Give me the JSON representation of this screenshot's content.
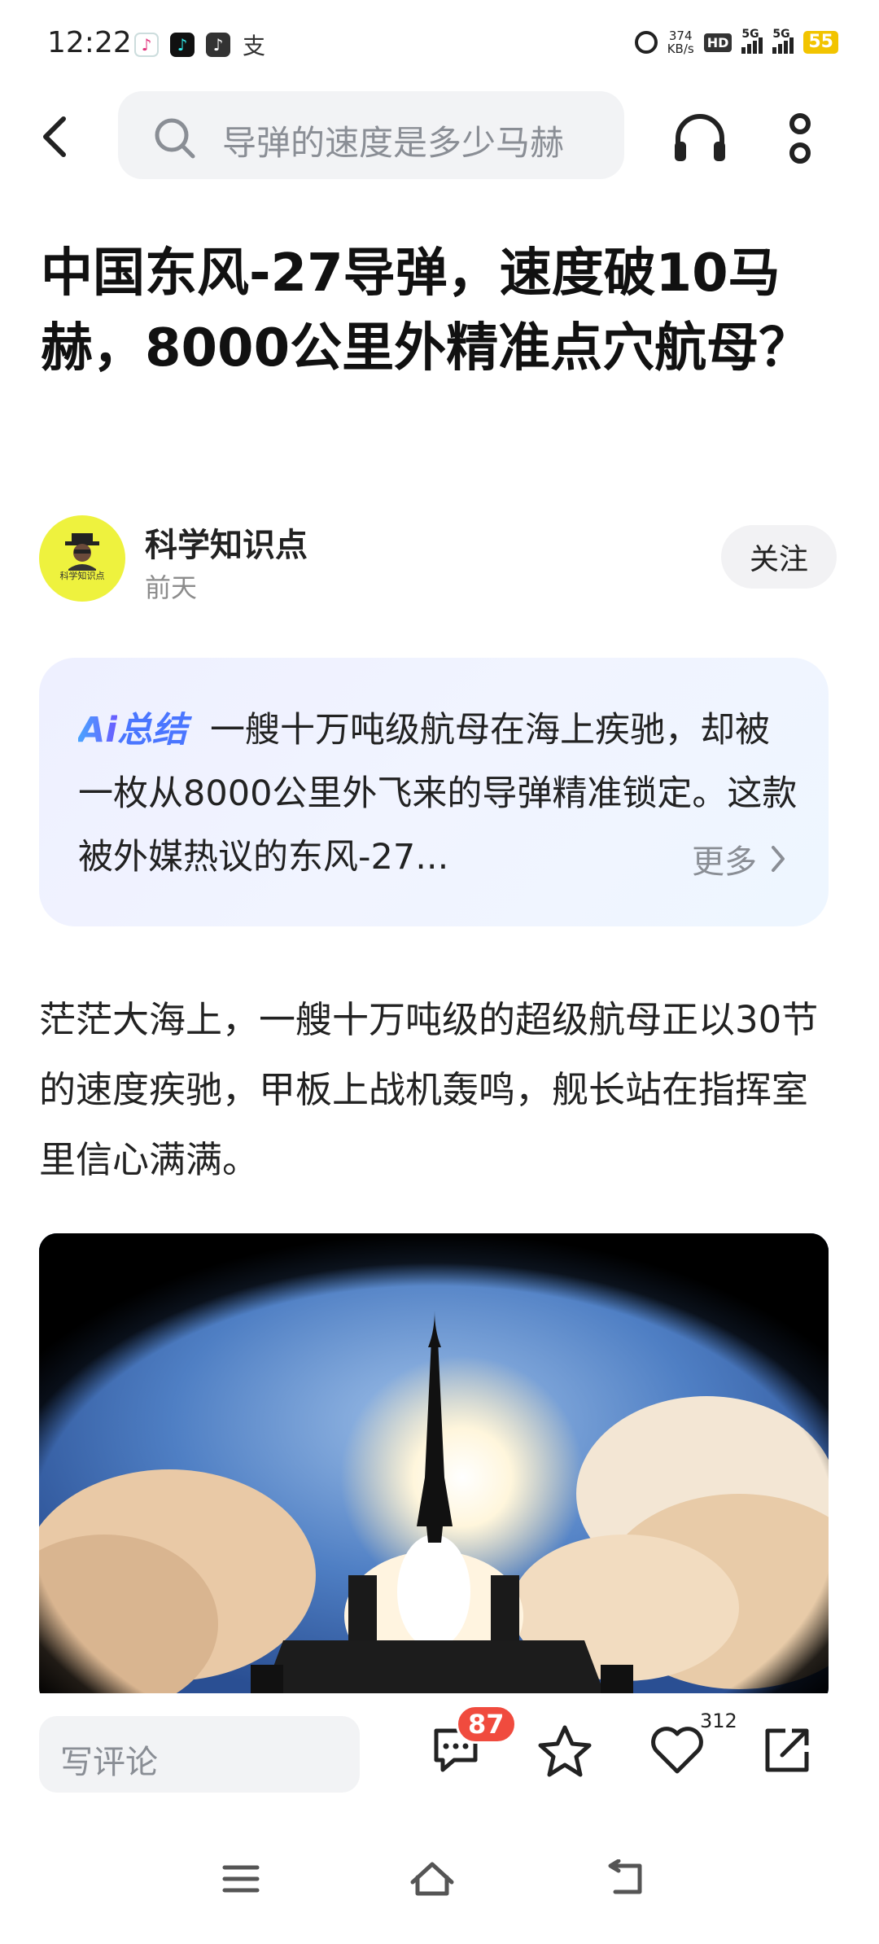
{
  "status_bar": {
    "time": "12:22",
    "net_speed_value": "374",
    "net_speed_unit": "KB/s",
    "hd_label": "HD",
    "signal1_label": "5G",
    "signal2_label": "5G",
    "battery": "55"
  },
  "nav": {
    "search_text": "导弹的速度是多少马赫"
  },
  "article": {
    "title": "中国东风-27导弹，速度破10马赫，8000公里外精准点穴航母？",
    "author_name": "科学知识点",
    "avatar_caption": "科学知识点",
    "post_time": "前天",
    "follow_label": "关注",
    "ai_badge_prefix": "Ai",
    "ai_badge_suffix": "总结",
    "ai_summary": "一艘十万吨级航母在海上疾驰，却被一枚从8000公里外飞来的导弹精准锁定。这款被外媒热议的东风-27...",
    "ai_more": "更多",
    "paragraph": "茫茫大海上，一艘十万吨级的超级航母正以30节的速度疾驰，甲板上战机轰鸣，舰长站在指挥室里信心满满。"
  },
  "bottom_bar": {
    "comment_placeholder": "写评论",
    "comment_count": "87",
    "like_count": "312"
  },
  "icons": {
    "back": "back-arrow-icon",
    "search": "search-icon",
    "listen": "headphone-icon",
    "more": "more-vertical-icon",
    "comment": "comment-icon",
    "favorite": "star-icon",
    "like": "heart-icon",
    "share": "share-icon"
  }
}
